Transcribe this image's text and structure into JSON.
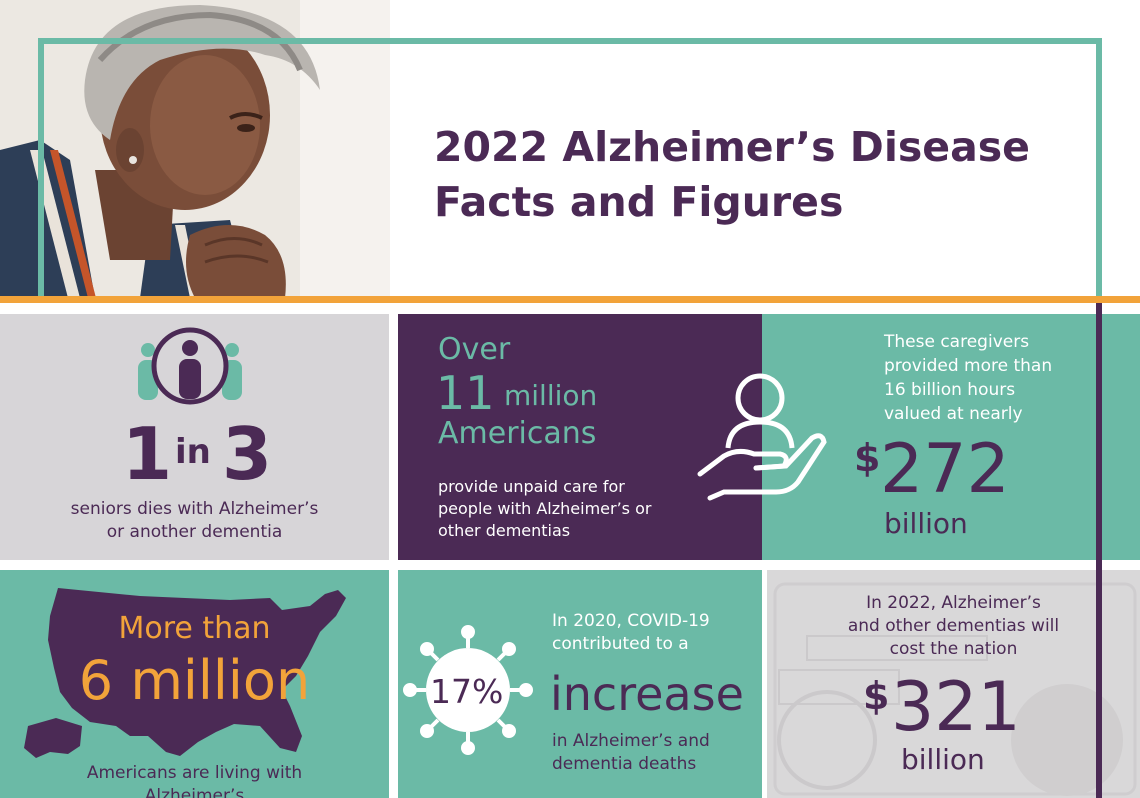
{
  "title": {
    "line1": "2022 Alzheimer’s Disease",
    "line2": "Facts and Figures"
  },
  "colors": {
    "purple": "#4b2a55",
    "teal": "#6bbaa6",
    "orange": "#f2a33a",
    "gray": "#d7d5d8"
  },
  "tiles": {
    "seniors": {
      "num1": "1",
      "in": "in",
      "num2": "3",
      "line1": "seniors dies with Alzheimer’s",
      "line2": "or another dementia"
    },
    "caregivers_count": {
      "over": "Over",
      "number": "11",
      "unit": "million",
      "who": "Americans",
      "line1": "provide unpaid care for",
      "line2": "people with Alzheimer’s or",
      "line3": "other dementias"
    },
    "care_value": {
      "line1": "These caregivers",
      "line2": "provided more than",
      "line3": "16 billion hours",
      "line4": "valued at nearly",
      "currency": "$",
      "amount": "272",
      "unit": "billion"
    },
    "living": {
      "more_than": "More than",
      "number": "6 million",
      "line1": "Americans are living with",
      "line2": "Alzheimer’s"
    },
    "covid": {
      "line1": "In 2020, COVID-19",
      "line2": "contributed to a",
      "percent": "17%",
      "increase": "increase",
      "line3": "in Alzheimer’s and",
      "line4": "dementia deaths"
    },
    "cost": {
      "line1": "In 2022, Alzheimer’s",
      "line2": "and other dementias will",
      "line3": "cost the nation",
      "currency": "$",
      "amount": "321",
      "unit": "billion"
    }
  }
}
